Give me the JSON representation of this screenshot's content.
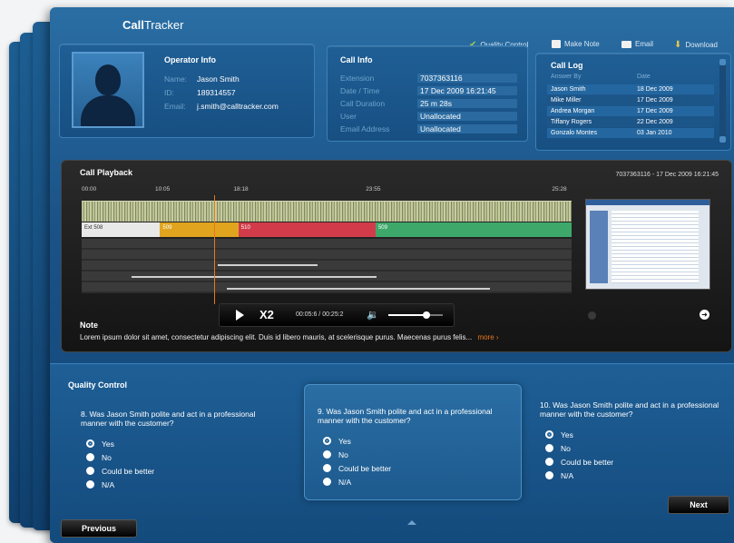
{
  "app": {
    "title_a": "Call",
    "title_b": "Tracker"
  },
  "toolbar": {
    "quality_control": "Quality Control",
    "make_note": "Make Note",
    "email": "Email",
    "download": "Download"
  },
  "operator": {
    "title": "Operator Info",
    "name_label": "Name:",
    "name": "Jason Smith",
    "id_label": "ID:",
    "id": "189314557",
    "email_label": "Email:",
    "email": "j.smith@calltracker.com"
  },
  "call_info": {
    "title": "Call Info",
    "rows": [
      {
        "label": "Extension",
        "value": "7037363116"
      },
      {
        "label": "Date / Time",
        "value": "17 Dec 2009 16:21:45"
      },
      {
        "label": "Call Duration",
        "value": "25 m 28s"
      },
      {
        "label": "User",
        "value": "Unallocated"
      },
      {
        "label": "Email Address",
        "value": "Unallocated"
      }
    ]
  },
  "call_log": {
    "title": "Call Log",
    "col_from": "Answer By",
    "col_date": "Date",
    "rows": [
      {
        "name": "Jason Smith",
        "date": "18 Dec 2009"
      },
      {
        "name": "Mike Miller",
        "date": "17 Dec 2009"
      },
      {
        "name": "Andrea Morgan",
        "date": "17 Dec 2009"
      },
      {
        "name": "Tiffany Rogers",
        "date": "22 Dec 2009"
      },
      {
        "name": "Gonzalo Montes",
        "date": "03 Jan 2010"
      }
    ]
  },
  "playback": {
    "title": "Call Playback",
    "header_right": "7037363116  -  17 Dec 2009 16:21:45",
    "time_marks": [
      "00:00",
      "10:05",
      "18:18",
      "23:55",
      "25:28"
    ],
    "segments": [
      {
        "label": "Ext 508",
        "color": "#e8e8e8"
      },
      {
        "label": "509",
        "color": "#e0a41f"
      },
      {
        "label": "510",
        "color": "#d23c4a"
      },
      {
        "label": "509",
        "color": "#3ea86a"
      }
    ],
    "speed": "X2",
    "time": "00:05:6 / 00:25:2",
    "playhead_pct": 27,
    "volume_pct": 70,
    "note_title": "Note",
    "note_text": "Lorem ipsum dolor sit amet, consectetur adipiscing elit. Duis id libero mauris, at scelerisque purus. Maecenas purus felis...",
    "more": "more ›"
  },
  "quality": {
    "title": "Quality Control",
    "questions": [
      {
        "q": "8. Was Jason Smith polite and act in a professional manner with the customer?",
        "options": [
          "Yes",
          "No",
          "Could be better",
          "N/A"
        ],
        "selected": 0
      },
      {
        "q": "9. Was Jason Smith polite and act in a professional manner with the customer?",
        "options": [
          "Yes",
          "No",
          "Could be better",
          "N/A"
        ],
        "selected": 0
      },
      {
        "q": "10. Was Jason Smith polite and act in a professional manner with the customer?",
        "options": [
          "Yes",
          "No",
          "Could be better",
          "N/A"
        ],
        "selected": 0
      }
    ],
    "previous": "Previous",
    "next": "Next"
  },
  "colors": {
    "accent": "#e8781c",
    "panel": "#1a5388",
    "dark_panel": "#1b1b1b"
  }
}
